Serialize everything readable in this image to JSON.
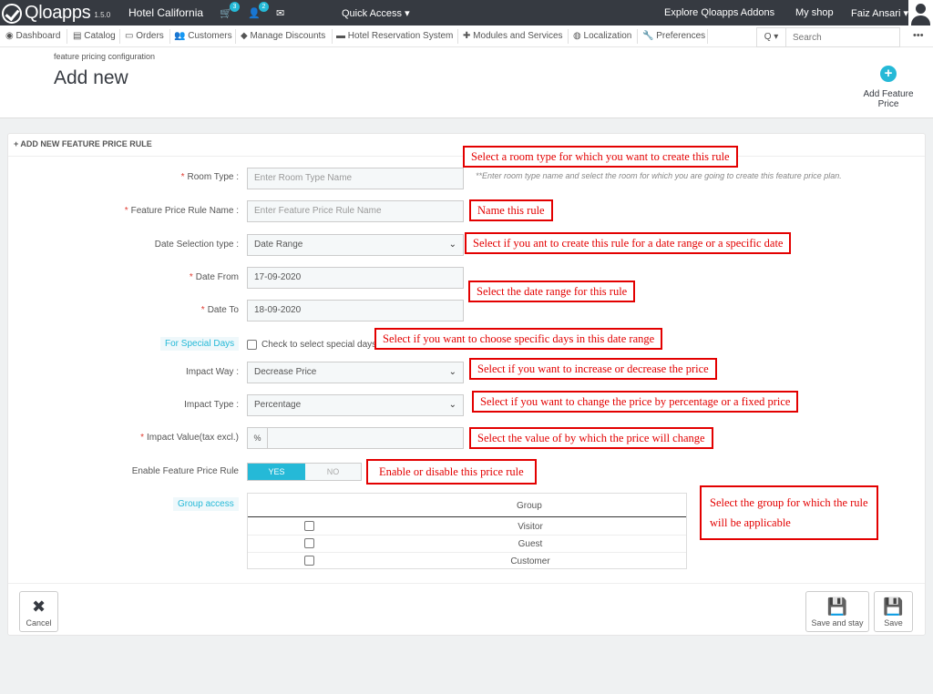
{
  "topbar": {
    "brand": "Qloapps",
    "version": "1.5.0",
    "shop_name": "Hotel California",
    "cart_count": "3",
    "user_count": "2",
    "quick_access": "Quick Access ▾",
    "explore": "Explore Qloapps Addons",
    "my_shop": "My shop",
    "user": "Faiz Ansari ▾"
  },
  "nav": {
    "items": [
      "Dashboard",
      "Catalog",
      "Orders",
      "Customers",
      "Manage Discounts",
      "Hotel Reservation System",
      "Modules and Services",
      "Localization",
      "Preferences"
    ],
    "search_placeholder": "Search",
    "search_btn": "Q ▾",
    "more": "•••"
  },
  "header": {
    "breadcrumb": "feature pricing configuration",
    "title": "Add new",
    "add_button": "Add Feature Price",
    "add_icon": "+"
  },
  "panel": {
    "heading": "+ ADD NEW FEATURE PRICE RULE",
    "room_type_label": "Room Type :",
    "room_type_placeholder": "Enter Room Type Name",
    "room_type_hint": "**Enter room type name and select the room for which you are going to create this feature price plan.",
    "rule_name_label": "Feature Price Rule Name :",
    "rule_name_placeholder": "Enter Feature Price Rule Name",
    "date_sel_label": "Date Selection type :",
    "date_sel_value": "Date Range",
    "date_from_label": "Date From",
    "date_from_value": "17-09-2020",
    "date_to_label": "Date To",
    "date_to_value": "18-09-2020",
    "special_days_label": "For Special Days",
    "special_days_check": "Check to select special days",
    "impact_way_label": "Impact Way :",
    "impact_way_value": "Decrease Price",
    "impact_type_label": "Impact Type :",
    "impact_type_value": "Percentage",
    "impact_value_label": "Impact Value(tax excl.)",
    "impact_value_prefix": "%",
    "enable_label": "Enable Feature Price Rule",
    "enable_yes": "YES",
    "enable_no": "NO",
    "group_label": "Group access",
    "group_header": "Group",
    "groups": [
      "Visitor",
      "Guest",
      "Customer"
    ]
  },
  "footer": {
    "cancel": "Cancel",
    "save_stay": "Save and stay",
    "save": "Save"
  },
  "annotations": {
    "a1": "Select a room type for which you want to create this rule",
    "a2": "Name this rule",
    "a3": "Select if you ant to create this rule for a date range or a specific date",
    "a4": "Select the date range for this rule",
    "a5": "Select if you want to choose specific days in this date range",
    "a6": "Select if you want to increase or decrease the price",
    "a7": "Select if you want to change the price by percentage or a fixed price",
    "a8": "Select the value of by which the price will change",
    "a9": "Enable or disable this price rule",
    "a10_line1": "Select the group for which the rule",
    "a10_line2": "will be applicable"
  },
  "colors": {
    "topbar": "#363a41",
    "accent": "#25b9d7",
    "annotation": "#e30000"
  }
}
